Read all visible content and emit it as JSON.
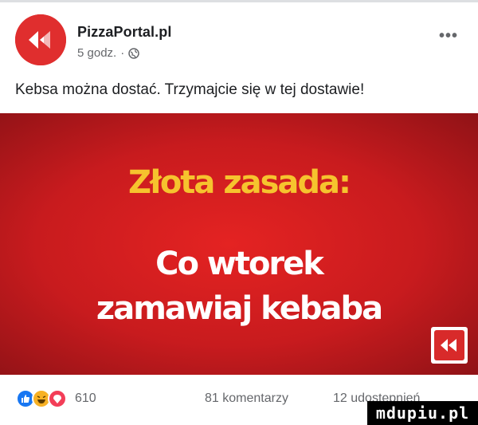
{
  "post": {
    "page_name": "PizzaPortal.pl",
    "time": "5 godz.",
    "separator": "·",
    "more_label": "•••",
    "text": "Kebsa można dostać. Trzymajcie się w tej dostawie!"
  },
  "image": {
    "title": "Złota zasada:",
    "line1": "Co wtorek",
    "line2": "zamawiaj kebaba",
    "colors": {
      "background": "#d41f20",
      "title": "#f6c32e",
      "text": "#ffffff"
    }
  },
  "footer": {
    "reactions": [
      "like-icon",
      "haha-icon",
      "wow-icon"
    ],
    "reaction_count": "610",
    "comments": "81 komentarzy",
    "shares": "12 udostępnień"
  },
  "watermark": "mdupiu.pl",
  "colors": {
    "brand": "#e02e2e",
    "meta": "#65676b"
  }
}
